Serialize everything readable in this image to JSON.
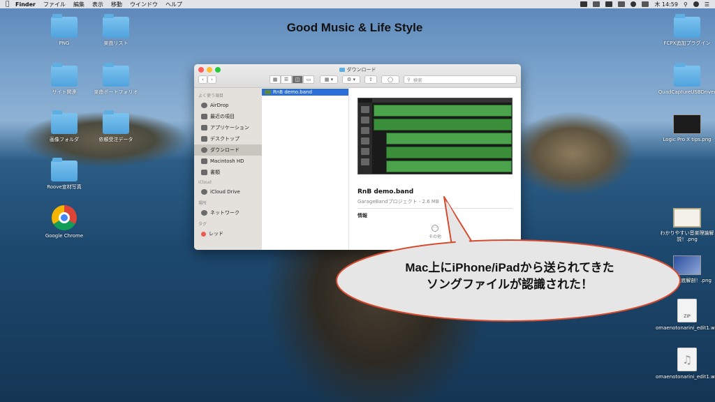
{
  "menubar": {
    "app": "Finder",
    "items": [
      "ファイル",
      "編集",
      "表示",
      "移動",
      "ウインドウ",
      "ヘルプ"
    ],
    "clock": "木 14:59"
  },
  "site_title": "Good Music & Life Style",
  "desktop_left": [
    {
      "label": "PNG",
      "type": "folder"
    },
    {
      "label": "楽曲リスト",
      "type": "folder"
    },
    {
      "label": "サイト関連",
      "type": "folder"
    },
    {
      "label": "楽曲ポートフォリオ",
      "type": "folder"
    },
    {
      "label": "画像フォルダ",
      "type": "folder"
    },
    {
      "label": "依頼受注データ",
      "type": "folder"
    },
    {
      "label": "Roove宣材写真",
      "type": "folder"
    },
    {
      "label": "Google Chrome",
      "type": "app"
    }
  ],
  "desktop_right": [
    {
      "label": "FCPX追加プラグイン",
      "type": "folder"
    },
    {
      "label": "QuadCaptureUSBDriver",
      "type": "folder"
    },
    {
      "label": "Logic Pro X tips.png",
      "type": "image"
    },
    {
      "label": "わかりやすい音楽理論解説！.png",
      "type": "image"
    },
    {
      "label": "beats徹底解剖！.png",
      "type": "image"
    },
    {
      "label": "omaenotonarini_edit1.wav.zip",
      "type": "zip"
    },
    {
      "label": "omaenotonarini_edit1.wav",
      "type": "audio"
    }
  ],
  "finder": {
    "title": "ダウンロード",
    "search_placeholder": "検索",
    "sidebar": {
      "favorites_header": "よく使う項目",
      "favorites": [
        "AirDrop",
        "最近の項目",
        "アプリケーション",
        "デスクトップ",
        "ダウンロード",
        "Macintosh HD",
        "書類"
      ],
      "active": "ダウンロード",
      "icloud_header": "iCloud",
      "icloud": [
        "iCloud Drive"
      ],
      "places_header": "場所",
      "places": [
        "ネットワーク"
      ],
      "tags_header": "タグ",
      "tags": [
        "レッド"
      ]
    },
    "selected_file": "RnB demo.band",
    "preview": {
      "name": "RnB demo.band",
      "meta": "GarageBandプロジェクト - 2.6 MB",
      "info_label": "情報",
      "more_label": "その他"
    }
  },
  "callout": {
    "line1": "Mac上にiPhone/iPadから送られてきた",
    "line2": "ソングファイルが認識された！"
  }
}
